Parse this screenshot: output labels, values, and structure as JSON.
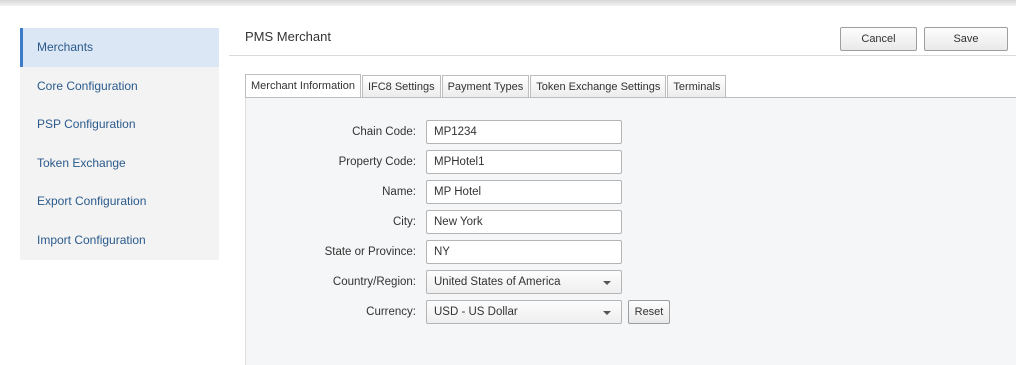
{
  "sidebar": {
    "items": [
      {
        "label": "Merchants"
      },
      {
        "label": "Core Configuration"
      },
      {
        "label": "PSP Configuration"
      },
      {
        "label": "Token Exchange"
      },
      {
        "label": "Export Configuration"
      },
      {
        "label": "Import Configuration"
      }
    ]
  },
  "header": {
    "title": "PMS Merchant",
    "cancel_label": "Cancel",
    "save_label": "Save"
  },
  "tabs": [
    {
      "label": "Merchant Information"
    },
    {
      "label": "IFC8 Settings"
    },
    {
      "label": "Payment Types"
    },
    {
      "label": "Token Exchange Settings"
    },
    {
      "label": "Terminals"
    }
  ],
  "form": {
    "chain_code": {
      "label": "Chain Code:",
      "value": "MP1234"
    },
    "property_code": {
      "label": "Property Code:",
      "value": "MPHotel1"
    },
    "name": {
      "label": "Name:",
      "value": "MP Hotel"
    },
    "city": {
      "label": "City:",
      "value": "New York"
    },
    "state": {
      "label": "State or Province:",
      "value": "NY"
    },
    "country": {
      "label": "Country/Region:",
      "value": "United States of America"
    },
    "currency": {
      "label": "Currency:",
      "value": "USD - US Dollar"
    },
    "reset_label": "Reset"
  },
  "colors": {
    "accent": "#3b7bc8",
    "link": "#2a5a8c",
    "active_bg": "#dbe7f4"
  },
  "icons": {
    "dropdown": "chevron-down-icon"
  }
}
